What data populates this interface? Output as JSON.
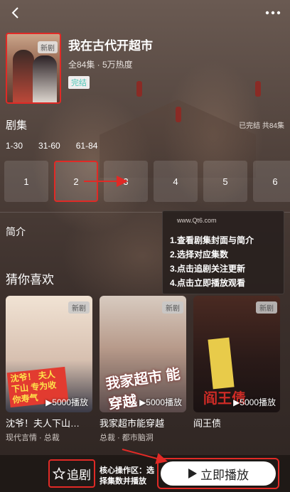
{
  "header": {
    "title": "我在古代开超市",
    "meta": "全84集 · 5万热度",
    "status": "完结",
    "cover_tag": "新剧"
  },
  "episodes": {
    "title": "剧集",
    "summary": "已完结 共84集",
    "ranges": [
      "1-30",
      "31-60",
      "61-84"
    ],
    "items": [
      "1",
      "2",
      "3",
      "4",
      "5",
      "6"
    ],
    "selected": "2"
  },
  "intro": {
    "label": "简介"
  },
  "panel": {
    "site": "www.Qt6.com",
    "steps": [
      "1.查看剧集封面与简介",
      "2.选择对应集数",
      "3.点击追剧关注更新",
      "4.点击立即播放观看"
    ]
  },
  "recommend": {
    "label": "猜你喜欢",
    "cards": [
      {
        "badge": "新剧",
        "plays": "5000播放",
        "name": "沈爷！夫人下山…",
        "sub": "现代言情 · 总裁",
        "banner": "沈爷！ 夫人下山 专为收你寿气"
      },
      {
        "badge": "新剧",
        "plays": "5000播放",
        "name": "我家超市能穿越",
        "sub": "总裁 · 都市脑洞",
        "banner": "我家超市 能穿越"
      },
      {
        "badge": "新剧",
        "plays": "5000播放",
        "name": "阎王债",
        "sub": "",
        "banner": "阎王债"
      }
    ]
  },
  "bottom": {
    "follow_label": "追剧",
    "core_note": "核心操作区：选择集数并播放",
    "play_label": "立即播放"
  },
  "colors": {
    "accent_red": "#e02a26",
    "status_teal": "#4cc7b6"
  },
  "icons": {
    "back": "back-arrow-icon",
    "more": "more-icon",
    "star": "star-icon",
    "play": "play-icon"
  }
}
